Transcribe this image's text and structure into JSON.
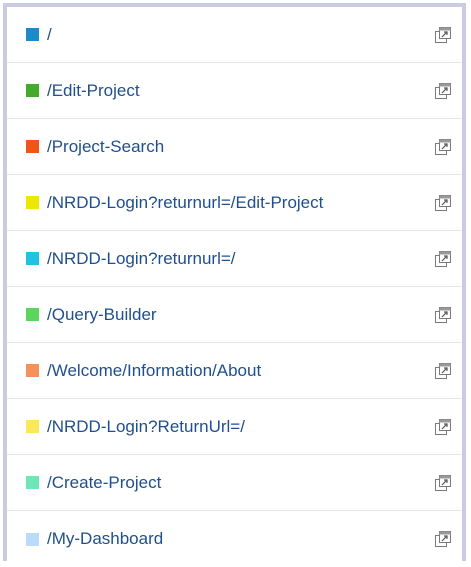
{
  "pages": [
    {
      "label": "/",
      "color": "#1a8bc8"
    },
    {
      "label": "/Edit-Project",
      "color": "#44aa2c"
    },
    {
      "label": "/Project-Search",
      "color": "#ee5517"
    },
    {
      "label": "/NRDD-Login?returnurl=/Edit-Project",
      "color": "#ede800"
    },
    {
      "label": "/NRDD-Login?returnurl=/",
      "color": "#20c4e0"
    },
    {
      "label": "/Query-Builder",
      "color": "#5dd45d"
    },
    {
      "label": "/Welcome/Information/About",
      "color": "#f4915a"
    },
    {
      "label": "/NRDD-Login?ReturnUrl=/",
      "color": "#fae85a"
    },
    {
      "label": "/Create-Project",
      "color": "#6fe6b8"
    },
    {
      "label": "/My-Dashboard",
      "color": "#b8dcfa"
    }
  ],
  "icons": {
    "open_external": "open-in-new-window-icon"
  }
}
